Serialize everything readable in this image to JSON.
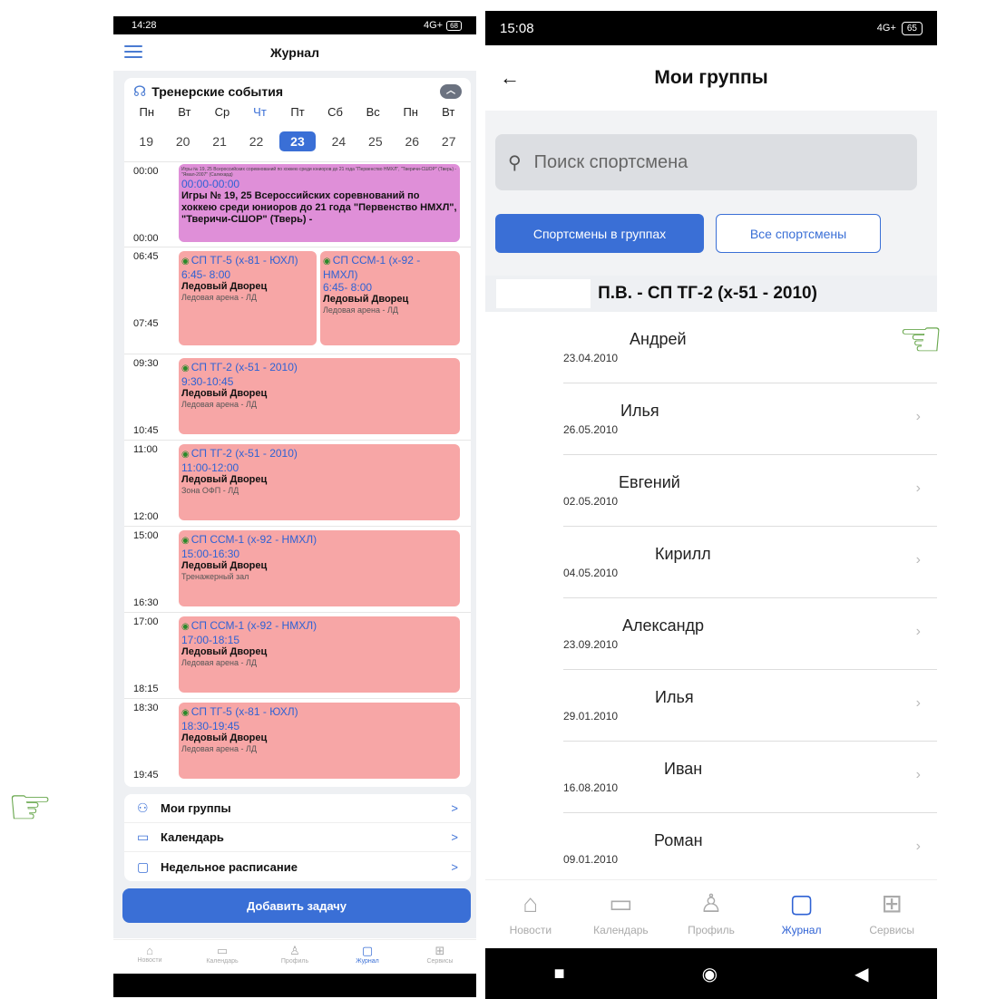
{
  "left": {
    "status": {
      "time": "14:28",
      "icons": "4G+",
      "battery": "68"
    },
    "title": "Журнал",
    "events_header": "Тренерские события",
    "weekdays": [
      "Пн",
      "Вт",
      "Ср",
      "Чт",
      "Пт",
      "Сб",
      "Вс",
      "Пн",
      "Вт"
    ],
    "dates": [
      "19",
      "20",
      "21",
      "22",
      "23",
      "24",
      "25",
      "26",
      "27"
    ],
    "slots": [
      {
        "start": "00:00",
        "end": "00:00",
        "tiny": "Игры № 19, 25 Всероссийских соревнований по хоккею среди юниоров до 21 года \"Первенство НМХЛ\", \"Тверичи-СШОР\" (Тверь) - \"Ямал-2007\" (Салехард)",
        "time": "00:00-00:00",
        "text": "Игры № 19, 25 Всероссийских соревнований по хоккею среди юниоров до 21 года \"Первенство НМХЛ\", \"Тверичи-СШОР\" (Тверь) -"
      },
      {
        "start": "06:45",
        "end": "07:45",
        "a": {
          "title": "СП ТГ-5 (х-81 - ЮХЛ)",
          "time": "6:45- 8:00",
          "loc": "Ледовый Дворец",
          "sub": "Ледовая арена - ЛД"
        },
        "b": {
          "title": "СП ССМ-1 (х-92 - НМХЛ)",
          "time": "6:45- 8:00",
          "loc": "Ледовый Дворец",
          "sub": "Ледовая арена - ЛД"
        }
      },
      {
        "start": "09:30",
        "end": "10:45",
        "title": "СП ТГ-2 (х-51 - 2010)",
        "time": "9:30-10:45",
        "loc": "Ледовый Дворец",
        "sub": "Ледовая арена - ЛД"
      },
      {
        "start": "11:00",
        "end": "12:00",
        "title": "СП ТГ-2 (х-51 - 2010)",
        "time": "11:00-12:00",
        "loc": "Ледовый Дворец",
        "sub": "Зона ОФП - ЛД"
      },
      {
        "start": "15:00",
        "end": "16:30",
        "title": "СП ССМ-1 (х-92 - НМХЛ)",
        "time": "15:00-16:30",
        "loc": "Ледовый Дворец",
        "sub": "Тренажерный зал"
      },
      {
        "start": "17:00",
        "end": "18:15",
        "title": "СП ССМ-1 (х-92 - НМХЛ)",
        "time": "17:00-18:15",
        "loc": "Ледовый Дворец",
        "sub": "Ледовая арена - ЛД"
      },
      {
        "start": "18:30",
        "end": "19:45",
        "title": "СП ТГ-5 (х-81 - ЮХЛ)",
        "time": "18:30-19:45",
        "loc": "Ледовый Дворец",
        "sub": "Ледовая арена - ЛД"
      }
    ],
    "menu": [
      "Мои группы",
      "Календарь",
      "Недельное расписание"
    ],
    "add_task": "Добавить задачу",
    "nav": [
      "Новости",
      "Календарь",
      "Профиль",
      "Журнал",
      "Сервисы"
    ]
  },
  "right": {
    "status": {
      "time": "15:08",
      "icons": "4G+",
      "battery": "65"
    },
    "title": "Мои группы",
    "search_placeholder": "Поиск спортсмена",
    "tab_groups": "Спортсмены в группах",
    "tab_all": "Все спортсмены",
    "group_title": "П.В. - СП ТГ-2 (х-51 - 2010)",
    "athletes": [
      {
        "name": "Андрей",
        "date": "23.04.2010"
      },
      {
        "name": "Илья",
        "date": "26.05.2010"
      },
      {
        "name": "Евгений",
        "date": "02.05.2010"
      },
      {
        "name": "Кирилл",
        "date": "04.05.2010"
      },
      {
        "name": "Александр",
        "date": "23.09.2010"
      },
      {
        "name": "Илья",
        "date": "29.01.2010"
      },
      {
        "name": "Иван",
        "date": "16.08.2010"
      },
      {
        "name": "Роман",
        "date": "09.01.2010"
      }
    ],
    "nav": [
      "Новости",
      "Календарь",
      "Профиль",
      "Журнал",
      "Сервисы"
    ]
  },
  "colors": {
    "accent": "#3a6fd6",
    "event_red": "#f7a6a6",
    "event_pink": "#df8fd8",
    "hand": "#6aa84f"
  }
}
